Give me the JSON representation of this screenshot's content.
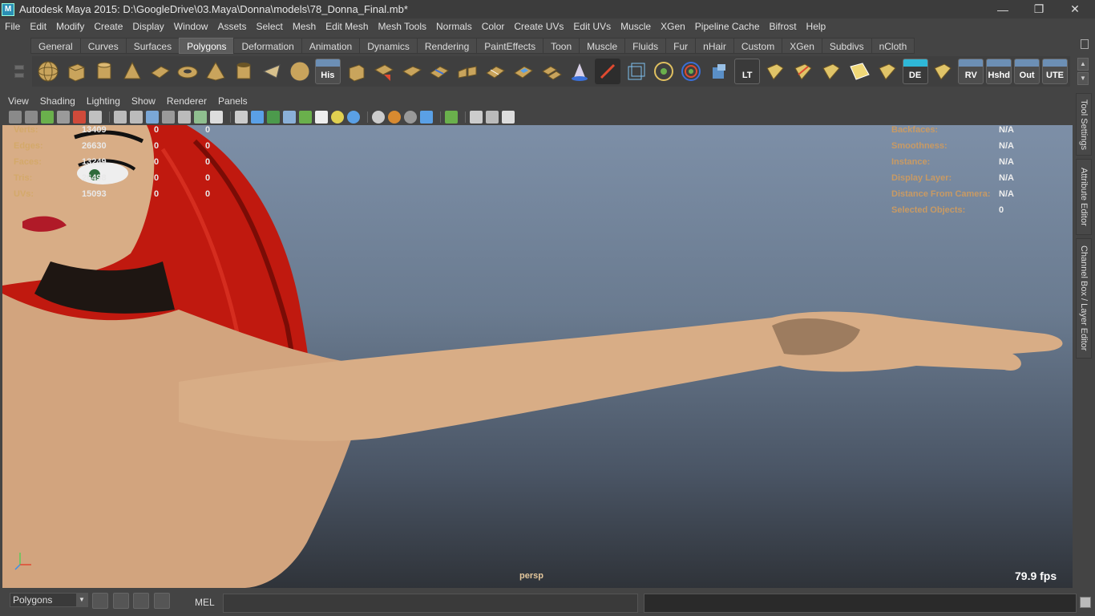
{
  "window": {
    "title": "Autodesk Maya 2015: D:\\GoogleDrive\\03.Maya\\Donna\\models\\78_Donna_Final.mb*",
    "controls": [
      "—",
      "❐",
      "✕"
    ]
  },
  "menu": [
    "File",
    "Edit",
    "Modify",
    "Create",
    "Display",
    "Window",
    "Assets",
    "Select",
    "Mesh",
    "Edit Mesh",
    "Mesh Tools",
    "Normals",
    "Color",
    "Create UVs",
    "Edit UVs",
    "Muscle",
    "XGen",
    "Pipeline Cache",
    "Bifrost",
    "Help"
  ],
  "shelf": {
    "tabs": [
      "General",
      "Curves",
      "Surfaces",
      "Polygons",
      "Deformation",
      "Animation",
      "Dynamics",
      "Rendering",
      "PaintEffects",
      "Toon",
      "Muscle",
      "Fluids",
      "Fur",
      "nHair",
      "Custom",
      "XGen",
      "Subdivs",
      "nCloth"
    ],
    "active_tab": "Polygons",
    "text_icons": {
      "his": "His",
      "lt": "LT",
      "de": "DE",
      "rv": "RV",
      "hshd": "Hshd",
      "out": "Out",
      "ute": "UTE"
    }
  },
  "panel_menu": [
    "View",
    "Shading",
    "Lighting",
    "Show",
    "Renderer",
    "Panels"
  ],
  "hud_left": [
    {
      "label": "Verts:",
      "v1": "13409",
      "v2": "0",
      "v3": "0"
    },
    {
      "label": "Edges:",
      "v1": "26630",
      "v2": "0",
      "v3": "0"
    },
    {
      "label": "Faces:",
      "v1": "13249",
      "v2": "0",
      "v3": "0"
    },
    {
      "label": "Tris:",
      "v1": "26498",
      "v2": "0",
      "v3": "0"
    },
    {
      "label": "UVs:",
      "v1": "15093",
      "v2": "0",
      "v3": "0"
    }
  ],
  "hud_right": [
    {
      "label": "Backfaces:",
      "value": "N/A"
    },
    {
      "label": "Smoothness:",
      "value": "N/A"
    },
    {
      "label": "Instance:",
      "value": "N/A"
    },
    {
      "label": "Display Layer:",
      "value": "N/A"
    },
    {
      "label": "Distance From Camera:",
      "value": "N/A"
    },
    {
      "label": "Selected Objects:",
      "value": "0"
    }
  ],
  "viewport": {
    "camera": "persp",
    "fps": "79.9 fps"
  },
  "side_tabs": [
    "Tool Settings",
    "Attribute Editor",
    "Channel Box / Layer Editor"
  ],
  "command_line": {
    "mode": "Polygons",
    "language": "MEL"
  },
  "colors": {
    "hair": "#cc1a12",
    "skin": "#d8ad86",
    "active_tab": "#5d5d5d"
  }
}
